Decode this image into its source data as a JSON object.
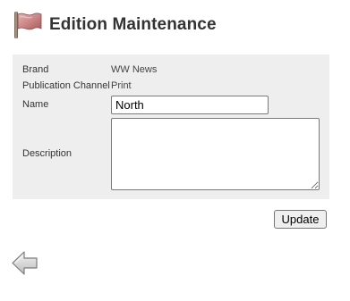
{
  "header": {
    "title": "Edition Maintenance",
    "icon": "flag-icon"
  },
  "form": {
    "brand_label": "Brand",
    "brand_value": "WW News",
    "channel_label": "Publication Channel",
    "channel_value": "Print",
    "name_label": "Name",
    "name_value": "North",
    "description_label": "Description",
    "description_value": ""
  },
  "actions": {
    "update_label": "Update",
    "back_icon": "back-arrow-icon"
  },
  "colors": {
    "panel_background": "#eeeeee",
    "flag_red": "#c97b7b",
    "arrow_gray": "#d8d8d8"
  }
}
